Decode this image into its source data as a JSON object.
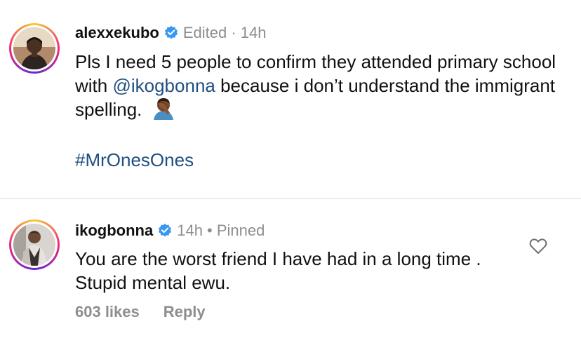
{
  "comments": [
    {
      "username": "alexxekubo",
      "meta": "Edited · 14h",
      "text_before": "Pls I need 5 people to confirm they attended primary school with ",
      "mention": "@ikogbonna",
      "text_after": " because i don’t understand the immigrant spelling.",
      "emoji": "facepalm-emoji",
      "hashtag": "#MrOnesOnes"
    },
    {
      "username": "ikogbonna",
      "meta": "14h • Pinned",
      "text": "You are the worst friend I have had in a long time . Stupid mental ewu.",
      "likes": "603 likes",
      "reply_label": "Reply"
    }
  ],
  "colors": {
    "link": "#1f4f82",
    "meta": "#8e8e8e",
    "verified": "#3897f0"
  }
}
